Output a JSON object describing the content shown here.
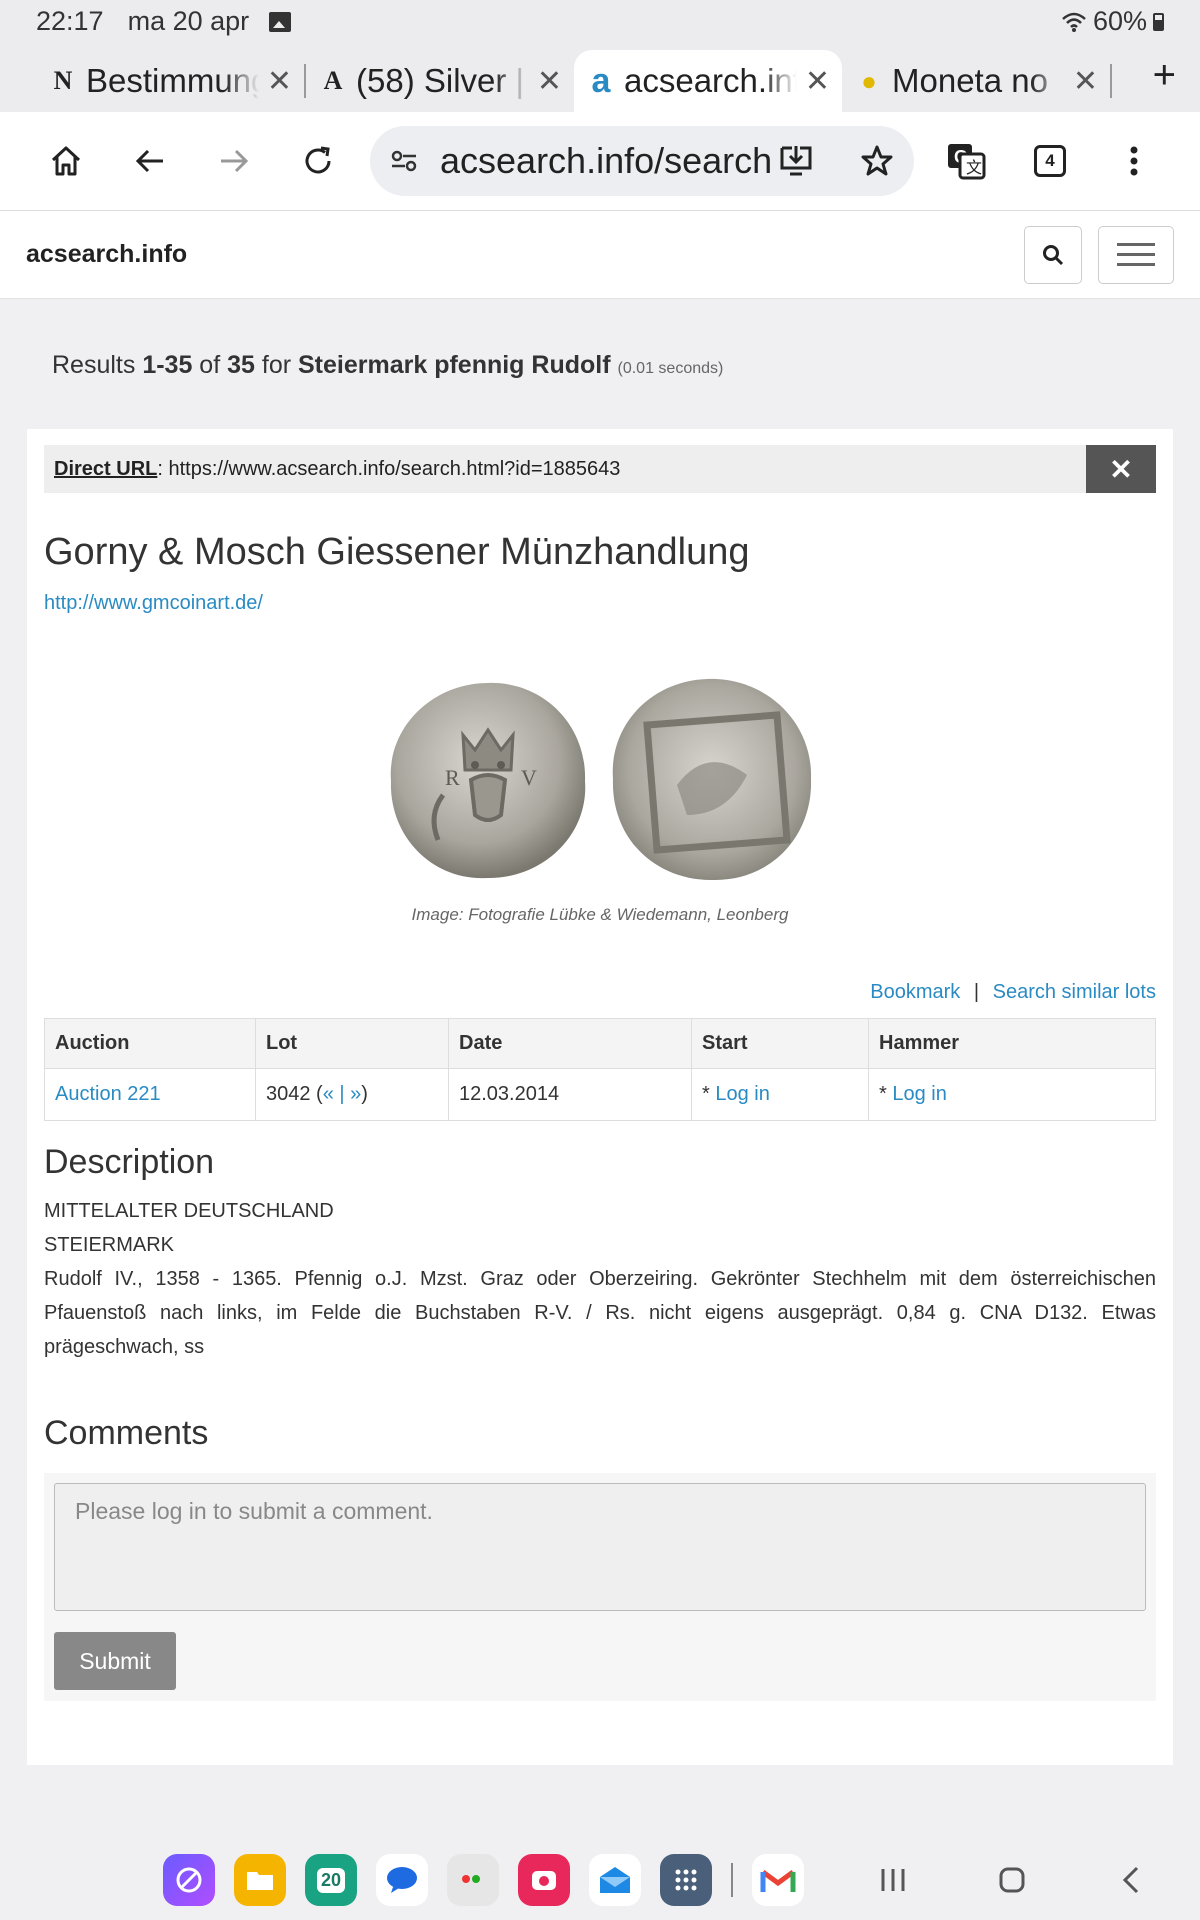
{
  "status_bar": {
    "time": "22:17",
    "date": "ma 20 apr",
    "battery": "60%"
  },
  "tabs": [
    {
      "favicon": "N",
      "label": "Bestimmung",
      "close": "✕"
    },
    {
      "favicon": "A",
      "label": "(58) Silver |",
      "close": "✕"
    },
    {
      "favicon": "a",
      "label": "acsearch.info",
      "close": "✕"
    },
    {
      "favicon": "●",
      "label": "Moneta no",
      "close": "✕"
    }
  ],
  "new_tab": "+",
  "address_bar": {
    "url": "acsearch.info/search",
    "tab_count": "4"
  },
  "site": {
    "brand": "acsearch.info"
  },
  "results": {
    "prefix": "Results ",
    "range": "1-35",
    "of": " of ",
    "total": "35",
    "for": " for ",
    "query": "Steiermark pfennig Rudolf",
    "time": "(0.01 seconds)"
  },
  "direct_url": {
    "label": "Direct URL",
    "value": ": https://www.acsearch.info/search.html?id=1885643",
    "close": "✕"
  },
  "lot": {
    "company": "Gorny & Mosch Giessener Münzhandlung",
    "company_url": "http://www.gmcoinart.de/",
    "image_caption": "Image: Fotografie Lübke & Wiedemann, Leonberg",
    "bookmark": "Bookmark",
    "separator": "|",
    "similar": "Search similar lots"
  },
  "table": {
    "headers": [
      "Auction",
      "Lot",
      "Date",
      "Start",
      "Hammer"
    ],
    "row": {
      "auction": "Auction 221",
      "lot": "3042 (",
      "prev": "«",
      "pipe": " | ",
      "next": "»",
      "lot_close": ")",
      "date": "12.03.2014",
      "start_star": "* ",
      "start_link": "Log in",
      "hammer_star": "* ",
      "hammer_link": "Log in"
    }
  },
  "description": {
    "heading": "Description",
    "line1": "MITTELALTER DEUTSCHLAND",
    "line2": "STEIERMARK",
    "body": "Rudolf IV., 1358 - 1365. Pfennig o.J. Mzst. Graz oder Oberzeiring. Gekrönter Stechhelm mit dem österreichischen Pfauenstoß nach links, im Felde die Buchstaben R-V. / Rs. nicht eigens ausgeprägt. 0,84 g. CNA D132. Etwas prägeschwach, ss"
  },
  "comments": {
    "heading": "Comments",
    "placeholder": "Please log in to submit a comment.",
    "submit": "Submit"
  },
  "dock": {
    "calendar_day": "20"
  }
}
